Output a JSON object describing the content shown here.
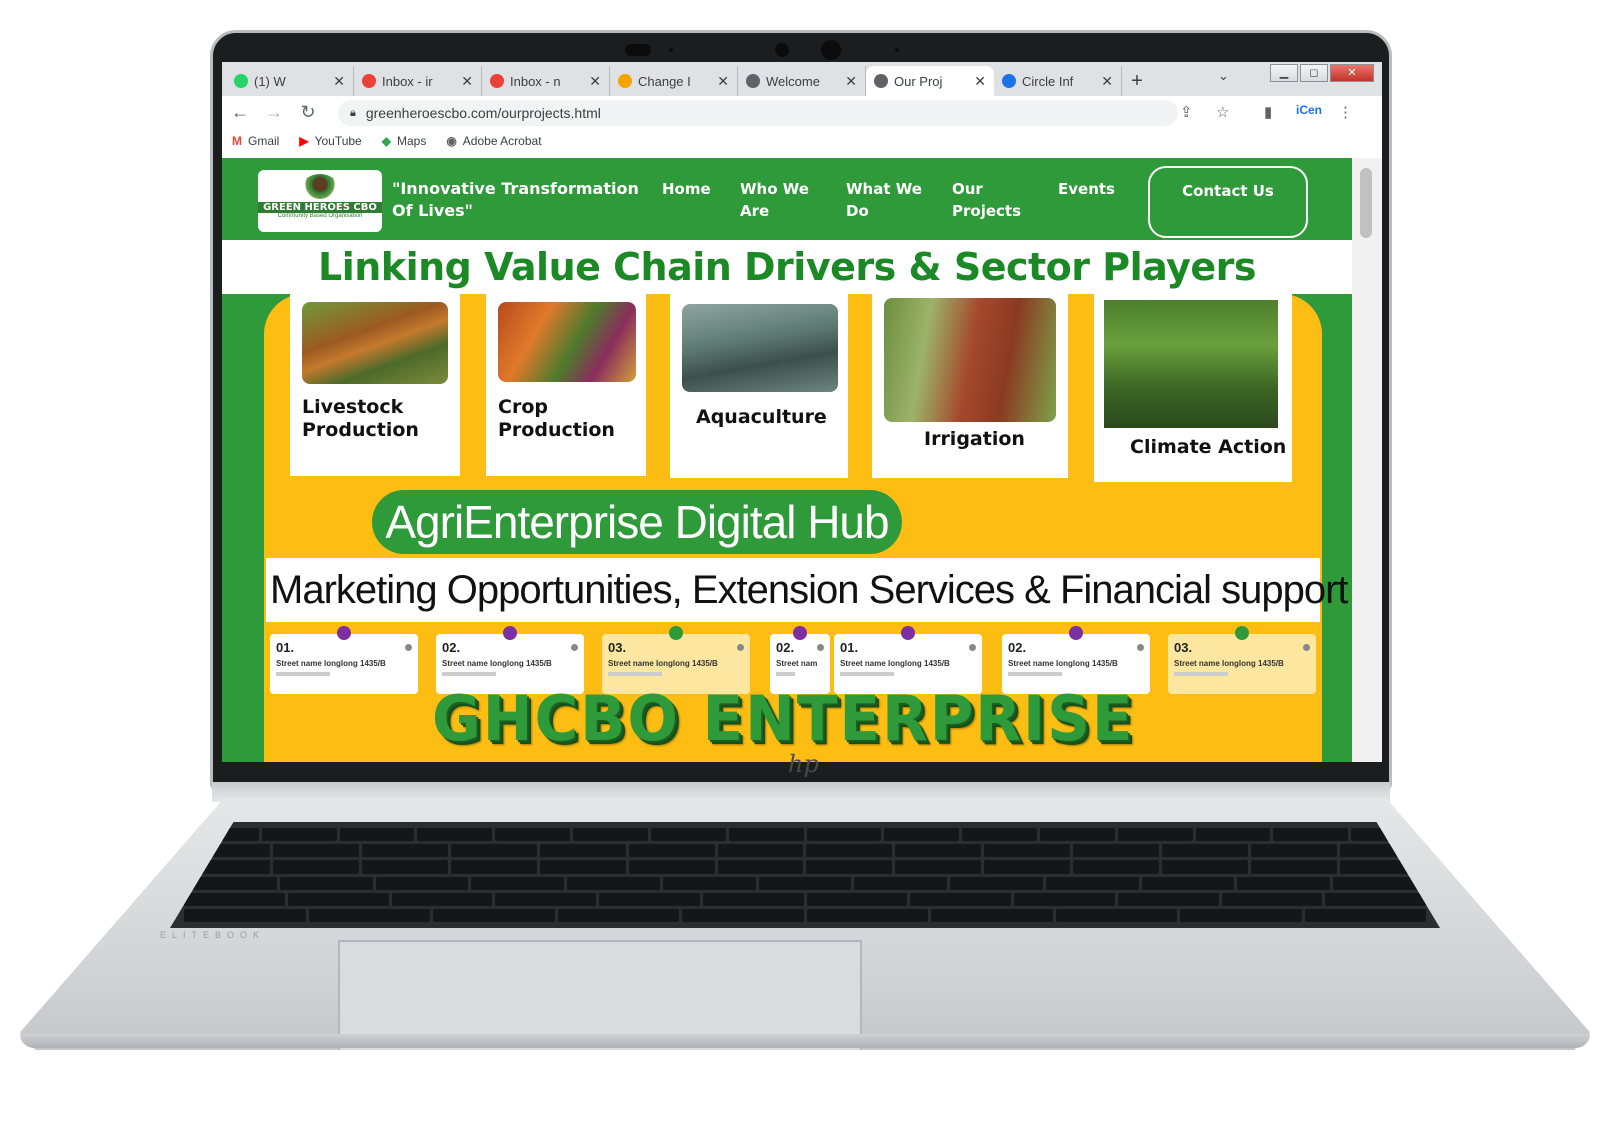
{
  "browser": {
    "tabs": [
      {
        "icon": "whatsapp-icon",
        "label": "(1) W",
        "color": "#25d366"
      },
      {
        "icon": "gmail-icon",
        "label": "Inbox - ir",
        "color": "#ea4335"
      },
      {
        "icon": "gmail-icon",
        "label": "Inbox - n",
        "color": "#ea4335"
      },
      {
        "icon": "cap-icon",
        "label": "Change I",
        "color": "#f4a400"
      },
      {
        "icon": "globe-icon",
        "label": "Welcome",
        "color": "#5f6368"
      },
      {
        "icon": "globe-icon",
        "label": "Our Proj",
        "color": "#5f6368",
        "active": true
      },
      {
        "icon": "circle-icon",
        "label": "Circle Inf",
        "color": "#1a73e8"
      }
    ],
    "new_tab": "+",
    "url": "greenheroescbo.com/ourprojects.html",
    "bookmarks": [
      {
        "icon": "gmail-icon",
        "label": "Gmail"
      },
      {
        "icon": "youtube-icon",
        "label": "YouTube"
      },
      {
        "icon": "maps-icon",
        "label": "Maps"
      },
      {
        "icon": "globe-icon",
        "label": "Adobe Acrobat"
      }
    ]
  },
  "site": {
    "logo": {
      "name": "GREEN HEROES CBO",
      "sub": "Community Based Organisation"
    },
    "tagline": "\"Innovative Transformation Of Lives\"",
    "nav": [
      {
        "label": "Home"
      },
      {
        "label": "Who We Are"
      },
      {
        "label": "What We Do"
      },
      {
        "label": "Our Projects"
      },
      {
        "label": "Events"
      }
    ],
    "contact": "Contact Us",
    "headline": "Linking Value Chain Drivers & Sector Players",
    "cards": [
      {
        "label": "Livestock Production",
        "image": "chicken-photo"
      },
      {
        "label": "Crop Production",
        "image": "vegetables-photo"
      },
      {
        "label": "Aquaculture",
        "image": "fish-pond-photo"
      },
      {
        "label": "Irrigation",
        "image": "drip-irrigation-photo"
      },
      {
        "label": "Climate Action",
        "image": "seedlings-photo"
      }
    ],
    "hub_title": "AgriEnterprise Digital Hub",
    "marketing": "Marketing Opportunities, Extension Services & Financial support",
    "address_cards": [
      {
        "num": "01.",
        "street": "Street name longlong 1435/B"
      },
      {
        "num": "02.",
        "street": "Street name longlong 1435/B"
      },
      {
        "num": "03.",
        "street": "Street name longlong 1435/B"
      },
      {
        "num": "02.",
        "street": "Street nam"
      },
      {
        "num": "01.",
        "street": "Street name longlong 1435/B"
      },
      {
        "num": "02.",
        "street": "Street name longlong 1435/B"
      },
      {
        "num": "03.",
        "street": "Street name longlong 1435/B"
      }
    ],
    "enterprise": "GHCBO ENTERPRISE"
  },
  "colors": {
    "brand_green": "#2e9a3a",
    "accent_yellow": "#fdbd12",
    "headline_green": "#1b8a24"
  }
}
